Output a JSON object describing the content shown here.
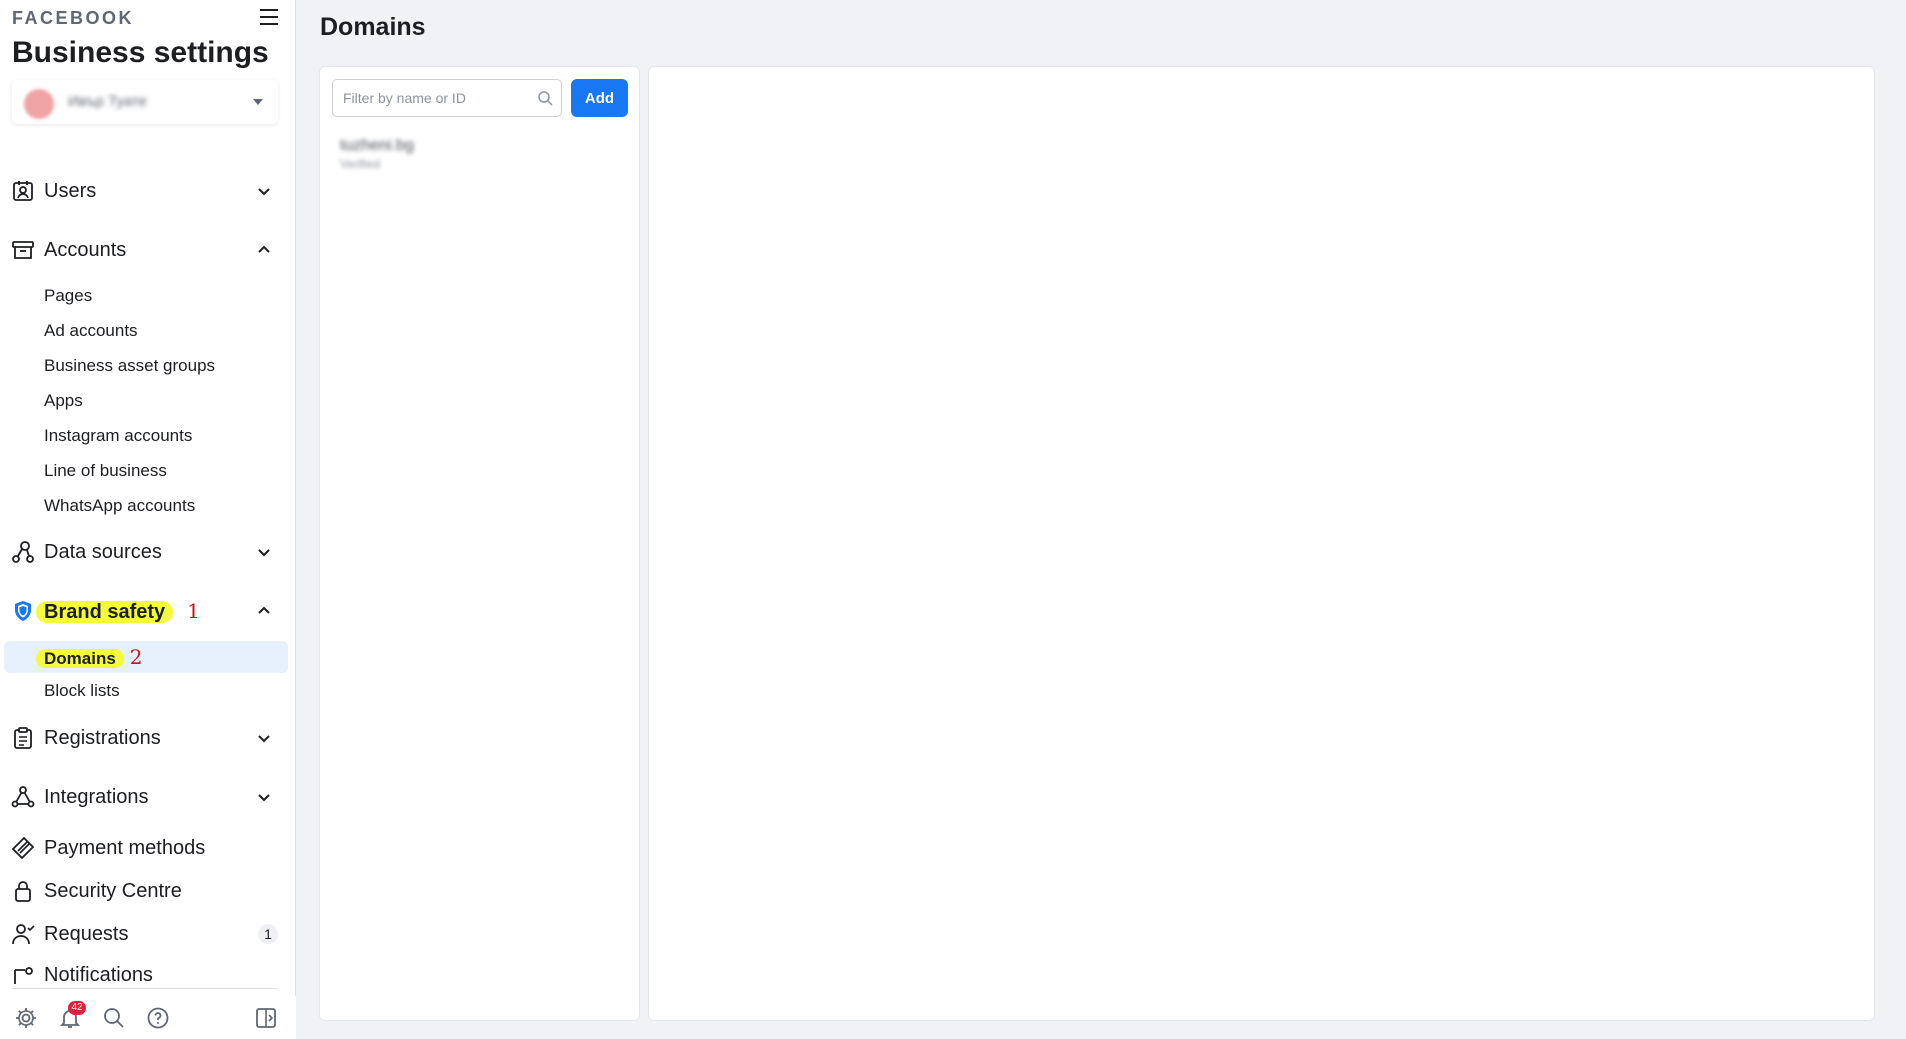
{
  "brand": "FACEBOOK",
  "title": "Business settings",
  "account": {
    "name": "Ивър Туате"
  },
  "sidebar": {
    "users": "Users",
    "accounts": {
      "label": "Accounts",
      "items": [
        "Pages",
        "Ad accounts",
        "Business asset groups",
        "Apps",
        "Instagram accounts",
        "Line of business",
        "WhatsApp accounts"
      ]
    },
    "data_sources": "Data sources",
    "brand_safety": {
      "label": "Brand safety",
      "annotation": "1",
      "items": [
        {
          "label": "Domains",
          "annotation": "2",
          "active": true
        },
        {
          "label": "Block lists"
        }
      ]
    },
    "registrations": "Registrations",
    "integrations": "Integrations",
    "payment_methods": "Payment methods",
    "security_centre": "Security Centre",
    "requests": {
      "label": "Requests",
      "count": "1"
    },
    "notifications": "Notifications"
  },
  "bottom_bar": {
    "notification_count": "42"
  },
  "main": {
    "page_title": "Domains",
    "filter_placeholder": "Filter by name or ID",
    "add_label": "Add",
    "domains": [
      {
        "name": "tuzheni.bg",
        "status": "Verified"
      }
    ]
  },
  "colors": {
    "accent": "#1877f2",
    "highlight": "#f3fb3a",
    "annotation": "#c01818",
    "active_bg": "#e7f0fd"
  }
}
